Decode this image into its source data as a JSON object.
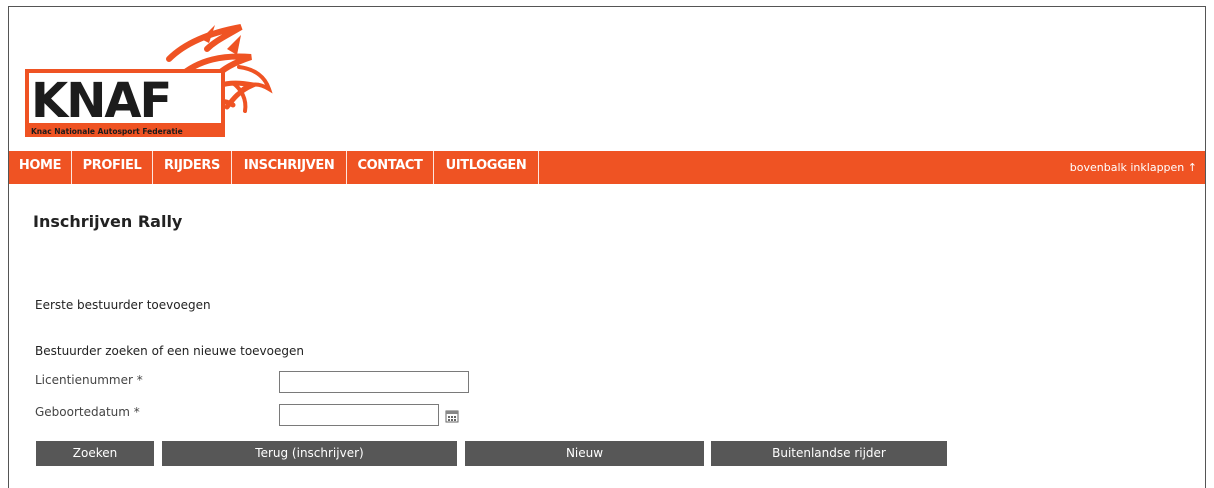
{
  "logo": {
    "wordmark": "KNAF",
    "tagline": "Knac Nationale Autosport Federatie",
    "accent": "#ef5323"
  },
  "nav": {
    "items": [
      "HOME",
      "PROFIEL",
      "RIJDERS",
      "INSCHRIJVEN",
      "CONTACT",
      "UITLOGGEN"
    ],
    "collapse_label": "bovenbalk inklappen ↑",
    "background": "#ef5323"
  },
  "page": {
    "title": "Inschrijven Rally",
    "subtitle": "Eerste bestuurder toevoegen",
    "search_heading": "Bestuurder zoeken of een nieuwe toevoegen"
  },
  "form": {
    "license_label": "Licentienummer *",
    "license_value": "",
    "birthdate_label": "Geboortedatum *",
    "birthdate_value": "",
    "calendar_icon": "calendar-icon"
  },
  "buttons": {
    "search": "Zoeken",
    "back": "Terug (inschrijver)",
    "new": "Nieuw",
    "foreign": "Buitenlandse rijder",
    "color": "#575757"
  }
}
